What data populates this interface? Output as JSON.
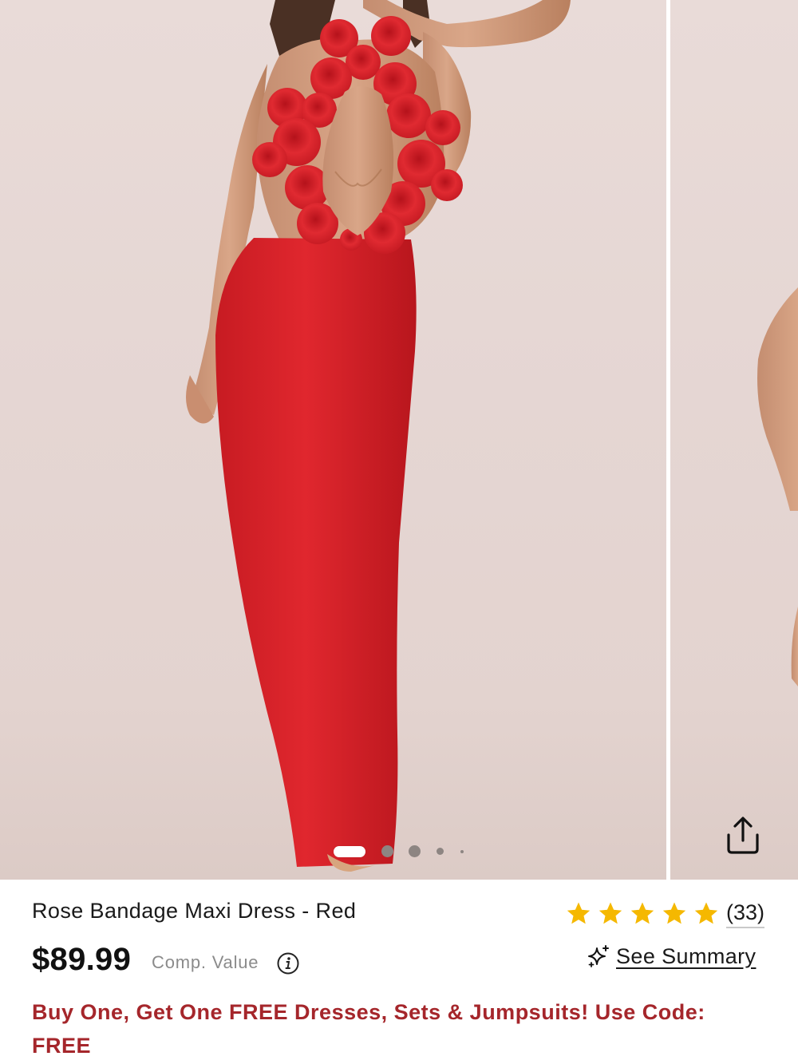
{
  "gallery": {
    "images": [
      {
        "alt": "Rose Bandage Maxi Dress - Red, front view"
      },
      {
        "alt": "Rose Bandage Maxi Dress - Red, alternate view"
      }
    ],
    "dots_count": 5,
    "active_dot": 0
  },
  "product": {
    "title": "Rose Bandage Maxi Dress - Red",
    "price": "$89.99",
    "comp_value_label": "Comp. Value",
    "rating_stars": 5,
    "rating_count": "(33)",
    "see_summary_label": "See Summary",
    "promo_text": "Buy One, Get One FREE Dresses, Sets & Jumpsuits! Use Code: FREE"
  },
  "icons": {
    "share": "share-icon",
    "info": "info-icon",
    "sparkle": "sparkle-icon",
    "star": "star-icon"
  },
  "colors": {
    "dress_red": "#d8232a",
    "promo_red": "#a5262b",
    "star_gold": "#f5b800",
    "backdrop": "#e6d7d4"
  }
}
